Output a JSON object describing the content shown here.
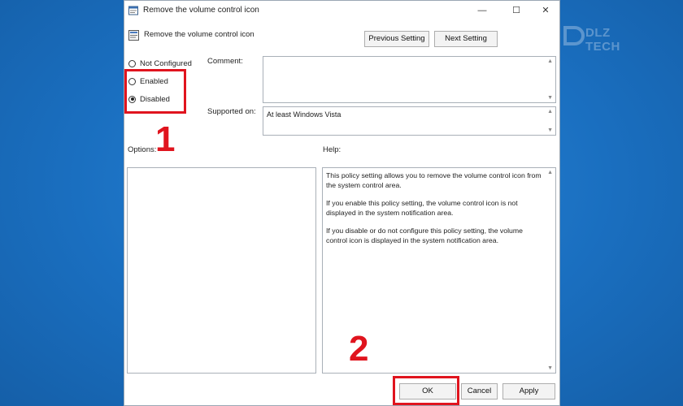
{
  "window": {
    "title": "Remove the volume control icon",
    "controls": {
      "minimize": "—",
      "maximize": "☐",
      "close": "✕"
    }
  },
  "policy": {
    "name": "Remove the volume control icon",
    "prev_button": "Previous Setting",
    "next_button": "Next Setting"
  },
  "options": {
    "not_configured": "Not Configured",
    "enabled": "Enabled",
    "disabled": "Disabled",
    "selected": "Disabled"
  },
  "fields": {
    "comment_label": "Comment:",
    "comment_value": "",
    "supported_label": "Supported on:",
    "supported_value": "At least Windows Vista",
    "options_label": "Options:",
    "help_label": "Help:"
  },
  "help": {
    "p1": "This policy setting allows you to remove the volume control icon from the system control area.",
    "p2": "If you enable this policy setting, the volume control icon is not displayed in the system notification area.",
    "p3": "If you disable or do not configure this policy setting, the volume control icon is displayed in the system notification area."
  },
  "footer": {
    "ok": "OK",
    "cancel": "Cancel",
    "apply": "Apply"
  },
  "annotations": {
    "step1": "1",
    "step2": "2",
    "highlight_color": "#e0141e"
  },
  "watermark": {
    "text": "DLZ TECH"
  },
  "colors": {
    "background": "#1a72c4",
    "dialog": "#ffffff",
    "button": "#f3f3f3"
  }
}
